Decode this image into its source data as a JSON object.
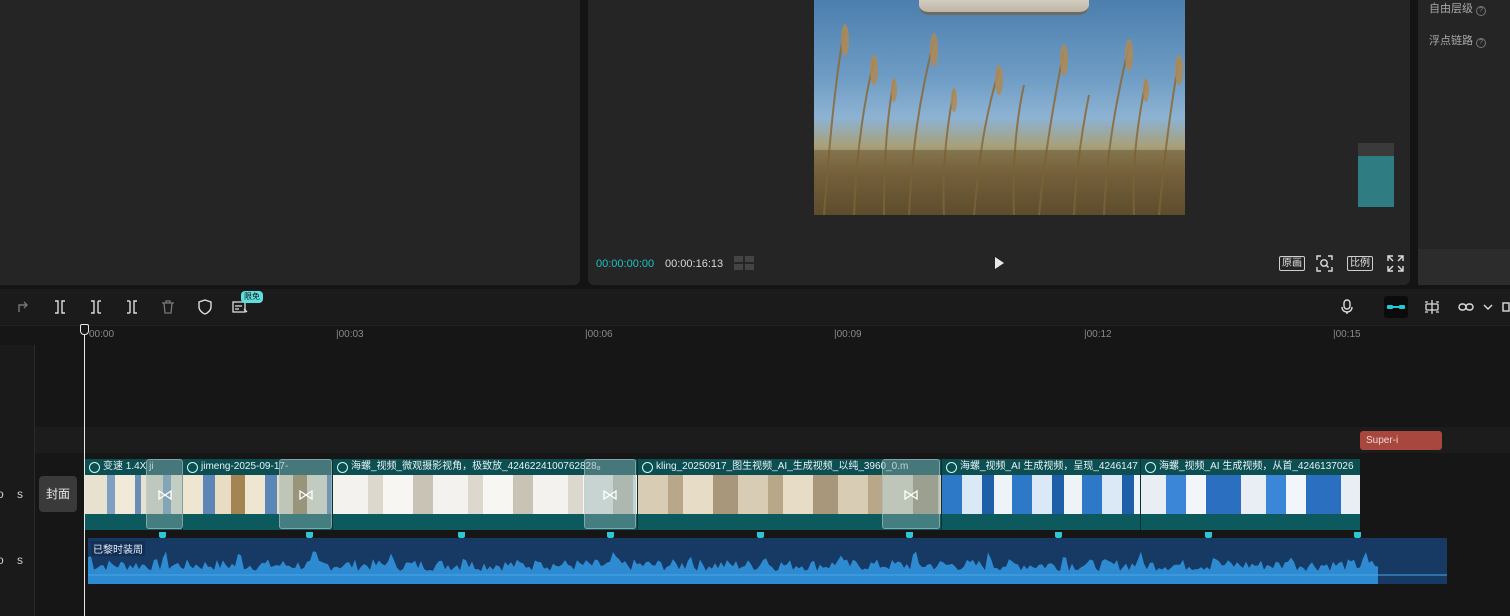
{
  "properties": {
    "item1": "自由层级",
    "item2": "浮点链路"
  },
  "player": {
    "current_time": "00:00:00:00",
    "total_time": "00:00:16:13",
    "btn_original": "原画",
    "btn_ratio": "比例",
    "volume_level": 0.8
  },
  "toolbar": {
    "badge": "限免"
  },
  "ruler": {
    "ticks": [
      "00:00",
      "|00:03",
      "|00:06",
      "|00:09",
      "|00:12",
      "|00:15"
    ]
  },
  "tracks": {
    "fx_clip": "Super-i",
    "cover_label": "封面",
    "video_head_o": "o",
    "video_head_s": "s",
    "audio_head_o": "o",
    "audio_head_s": "s",
    "clips": [
      "变速 1.4X  ji",
      "jimeng-2025-09-17-",
      "海螺_视频_微观摄影视角，极致放_4246224100762828₈",
      "kling_20250917_图生视频_AI_生成视频_以纯_3960_0.m",
      "海螺_视频_AI 生成视频，呈现_4246147",
      "海螺_视频_AI 生成视频，从首_4246137026"
    ],
    "audio_label": "已黎时装周"
  },
  "colors": {
    "accent": "#1fc2c2",
    "video_track": "#0c4b4f",
    "audio_track": "#163a64",
    "fx_clip": "#a8473e"
  }
}
